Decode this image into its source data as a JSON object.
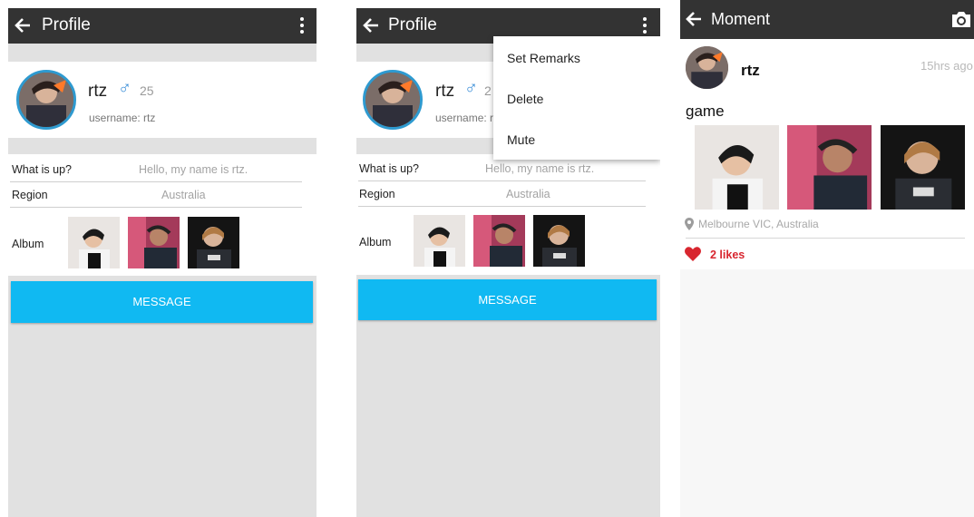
{
  "profile": {
    "title": "Profile",
    "name": "rtz",
    "gender_symbol": "♂",
    "age": "25",
    "username_line": "username: rtz",
    "whatsup_label": "What is up?",
    "whatsup_value": "Hello, my name is rtz.",
    "region_label": "Region",
    "region_value": "Australia",
    "album_label": "Album",
    "message_button": "MESSAGE",
    "age_truncated": "2"
  },
  "menu": {
    "items": [
      {
        "label": "Set Remarks"
      },
      {
        "label": "Delete"
      },
      {
        "label": "Mute"
      }
    ]
  },
  "moment": {
    "title": "Moment",
    "name": "rtz",
    "time": "15hrs ago",
    "text": "game",
    "location": "Melbourne VIC, Australia",
    "likes": "2 likes"
  },
  "colors": {
    "appbar": "#333333",
    "accent": "#10b9f2",
    "like": "#d8262f",
    "avatar_ring": "#2e9ad0"
  },
  "icons": [
    "back-arrow-icon",
    "more-vert-icon",
    "male-icon",
    "camera-icon",
    "location-pin-icon",
    "heart-icon"
  ]
}
